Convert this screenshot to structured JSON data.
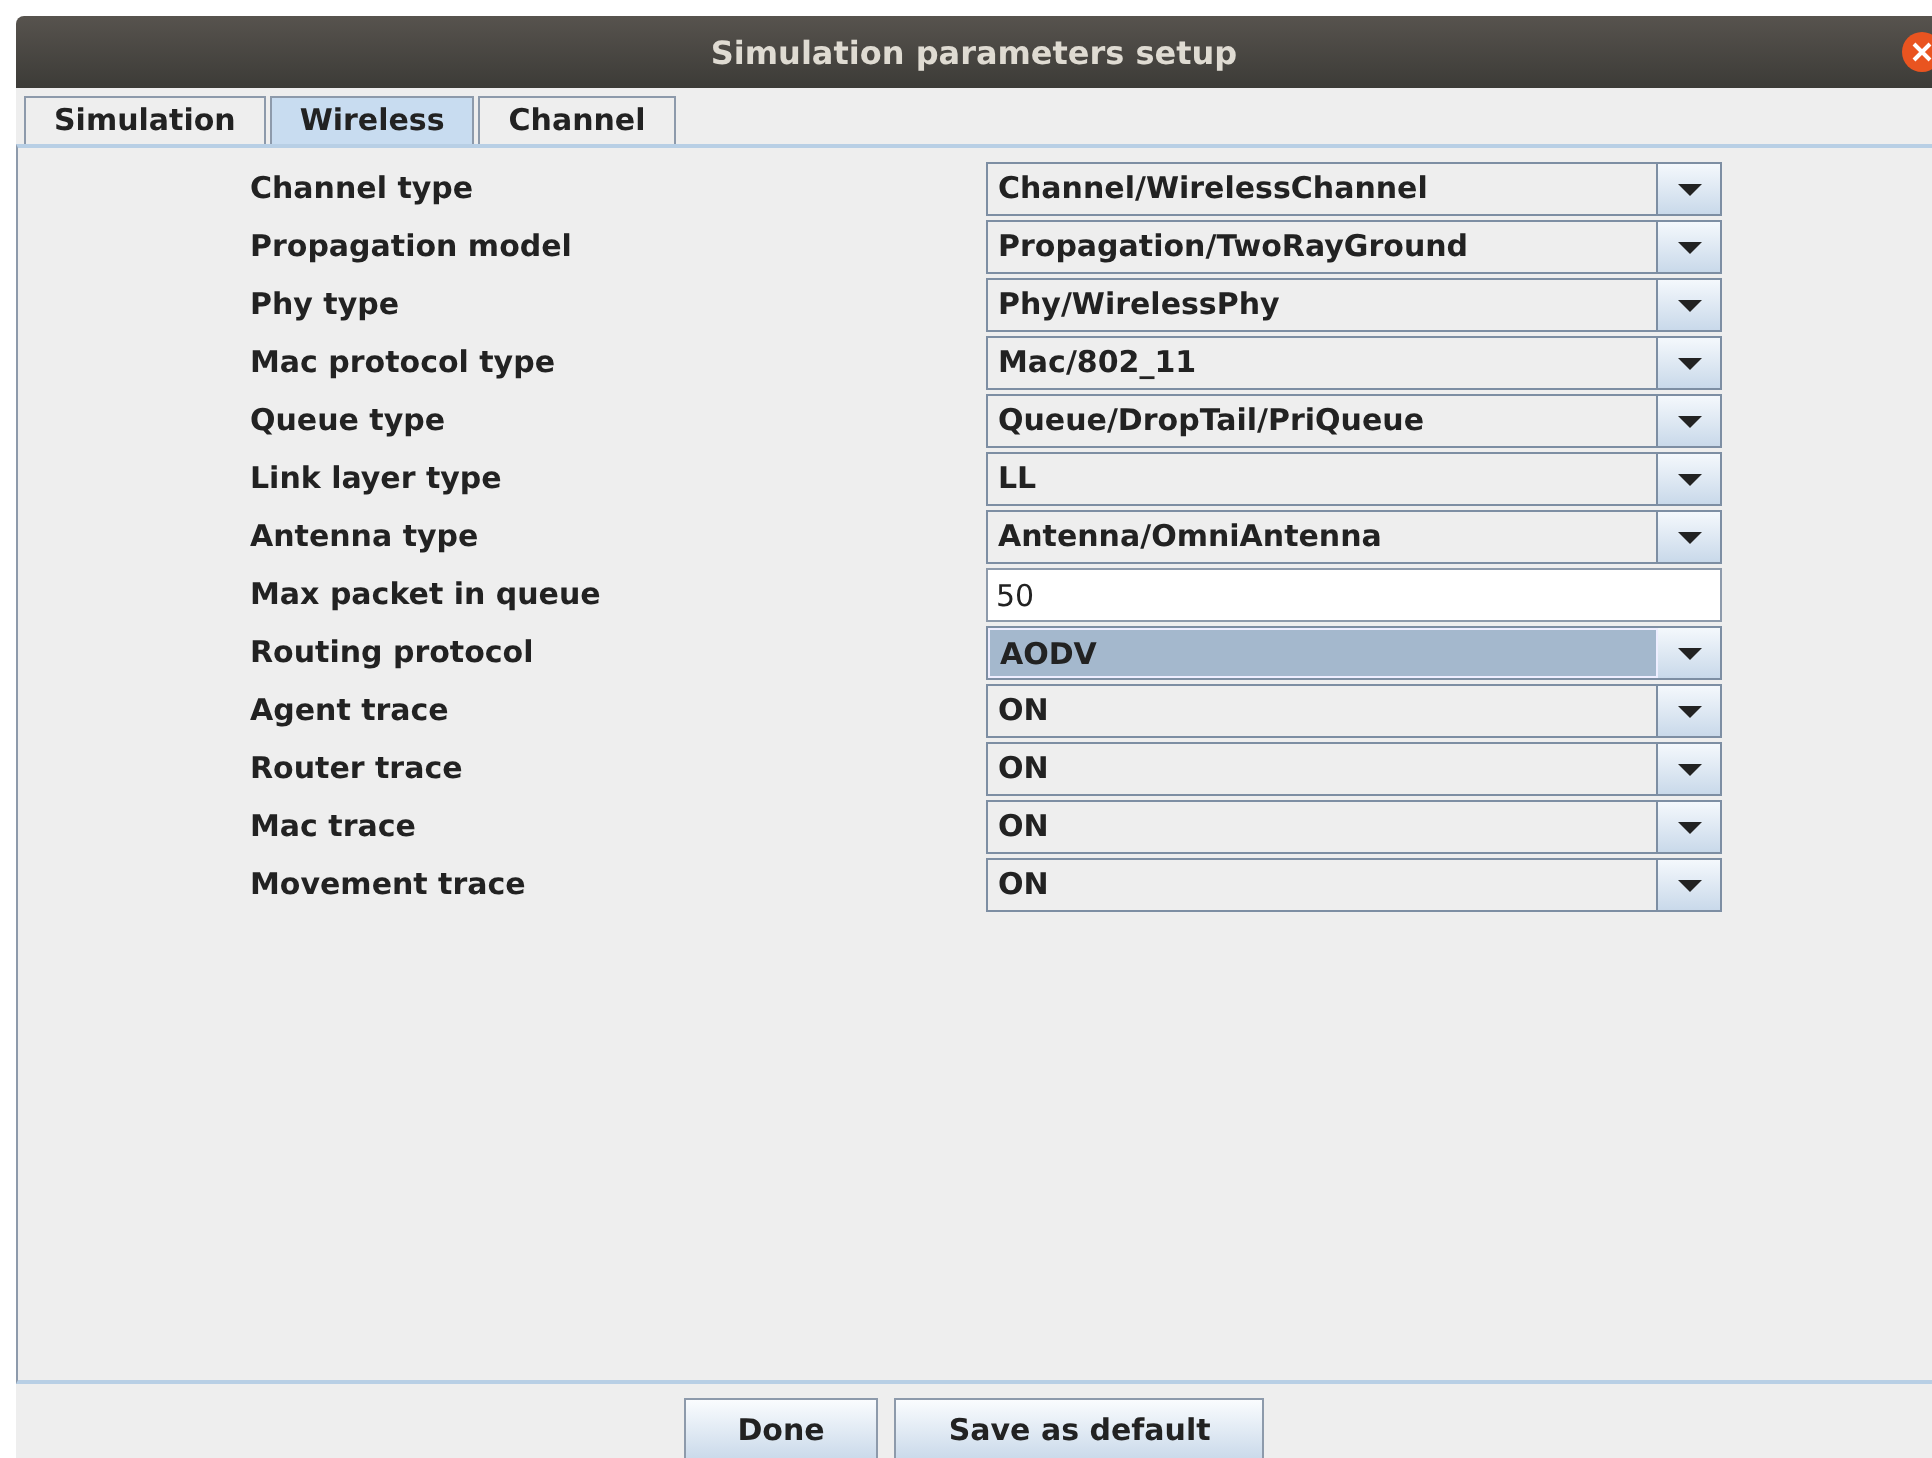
{
  "window": {
    "title": "Simulation parameters setup"
  },
  "tabs": [
    {
      "label": "Simulation",
      "selected": false
    },
    {
      "label": "Wireless",
      "selected": true
    },
    {
      "label": "Channel",
      "selected": false
    }
  ],
  "fields": [
    {
      "label": "Channel type",
      "kind": "combo",
      "value": "Channel/WirelessChannel",
      "focused": false
    },
    {
      "label": "Propagation model",
      "kind": "combo",
      "value": "Propagation/TwoRayGround",
      "focused": false
    },
    {
      "label": "Phy type",
      "kind": "combo",
      "value": "Phy/WirelessPhy",
      "focused": false
    },
    {
      "label": "Mac protocol type",
      "kind": "combo",
      "value": "Mac/802_11",
      "focused": false
    },
    {
      "label": "Queue type",
      "kind": "combo",
      "value": "Queue/DropTail/PriQueue",
      "focused": false
    },
    {
      "label": "Link layer type",
      "kind": "combo",
      "value": "LL",
      "focused": false
    },
    {
      "label": "Antenna type",
      "kind": "combo",
      "value": "Antenna/OmniAntenna",
      "focused": false
    },
    {
      "label": "Max packet in queue",
      "kind": "text",
      "value": "50",
      "focused": false
    },
    {
      "label": "Routing protocol",
      "kind": "combo",
      "value": "AODV",
      "focused": true
    },
    {
      "label": "Agent trace",
      "kind": "combo",
      "value": "ON",
      "focused": false
    },
    {
      "label": "Router trace",
      "kind": "combo",
      "value": "ON",
      "focused": false
    },
    {
      "label": "Mac trace",
      "kind": "combo",
      "value": "ON",
      "focused": false
    },
    {
      "label": "Movement trace",
      "kind": "combo",
      "value": "ON",
      "focused": false
    }
  ],
  "buttons": [
    "Done",
    "Save as default"
  ]
}
